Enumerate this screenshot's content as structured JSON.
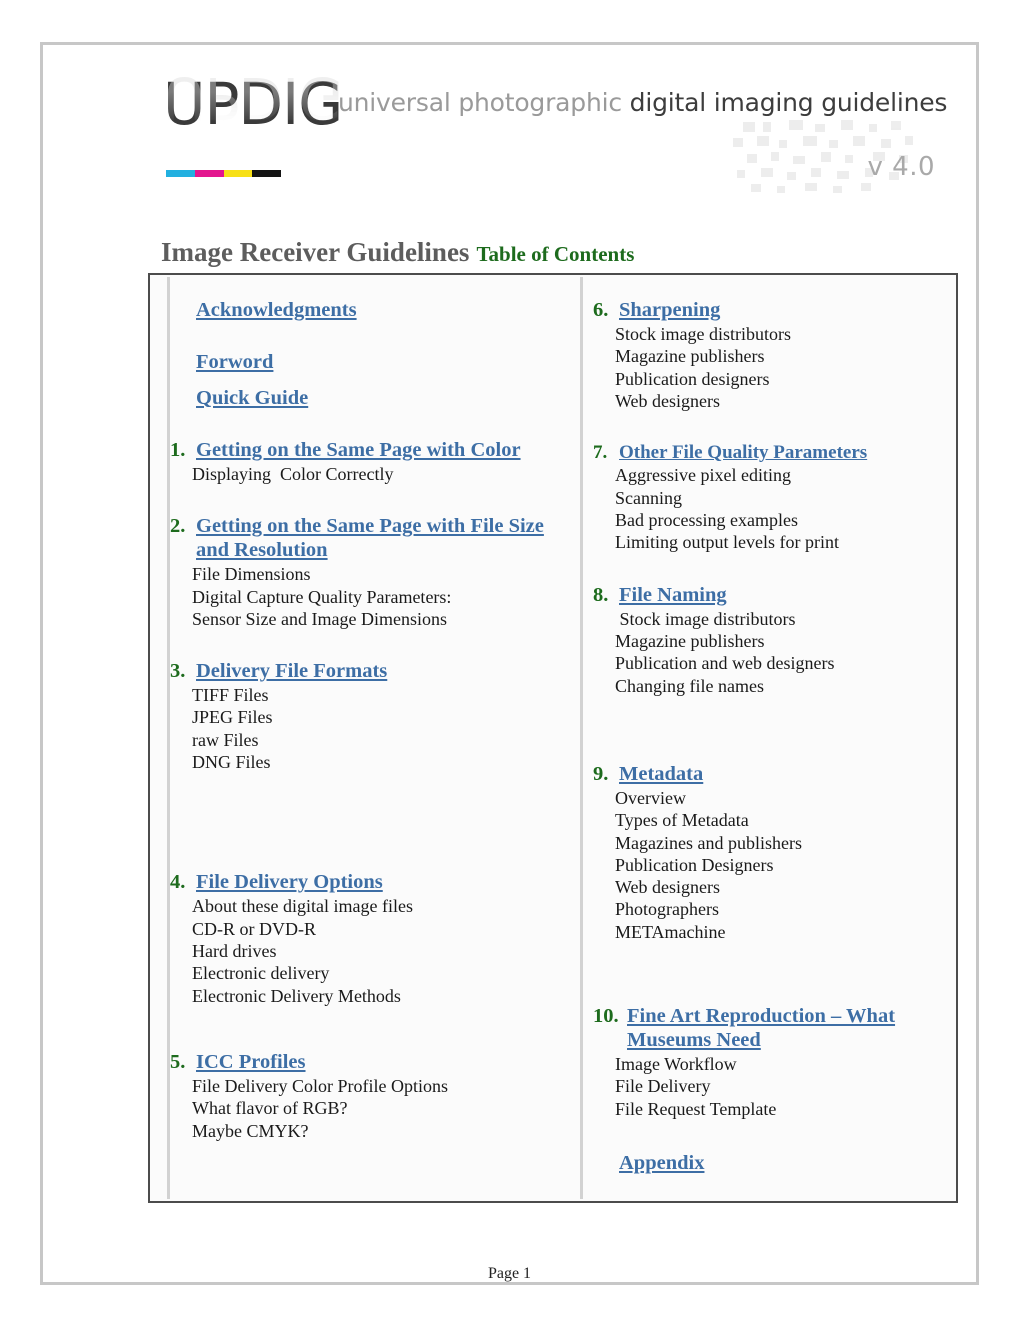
{
  "logo": {
    "wordmark": "UPDIG",
    "tagline_light": "universal photographic ",
    "tagline_bold": "digital imaging guidelines",
    "version": "v 4.0",
    "cmyk_colors": [
      "#22b0e0",
      "#e3168f",
      "#f7e017",
      "#141414"
    ]
  },
  "title": {
    "main": "Image Receiver Guidelines",
    "sub": "Table of Contents",
    "main_color": "#5d5d5d",
    "sub_color": "#1d6b1d"
  },
  "colors": {
    "link": "#3d6ea5",
    "number": "#1d6b1d",
    "body_text": "#1a1a1a",
    "table_border": "#4c4c4c",
    "cell_border": "#d2d2d2",
    "page_border": "#c7c7c7"
  },
  "toc": {
    "left_column": [
      {
        "number": "",
        "label": "Acknowledgments",
        "is_link": true,
        "sub_items": [],
        "gap_after": 28
      },
      {
        "number": "",
        "label": "Forword",
        "is_link": true,
        "sub_items": [],
        "gap_after": 12
      },
      {
        "number": "",
        "label": "Quick Guide",
        "is_link": true,
        "sub_items": [],
        "gap_after": 28
      },
      {
        "number": "1.",
        "label": "Getting on the Same Page with Color",
        "is_link": true,
        "sub_items": [
          "Displaying  Color Correctly"
        ],
        "gap_after": 30
      },
      {
        "number": "2.",
        "label": "Getting on the Same Page with File Size and Resolution",
        "is_link": true,
        "sub_items": [
          "File Dimensions",
          "Digital Capture Quality Parameters:",
          "Sensor Size and Image Dimensions"
        ],
        "gap_after": 30
      },
      {
        "number": "3.",
        "label": "Delivery File Formats",
        "is_link": true,
        "sub_items": [
          "TIFF Files",
          "JPEG Files",
          "raw Files",
          "DNG Files"
        ],
        "gap_after": 98
      },
      {
        "number": "4.",
        "label": "File Delivery Options",
        "is_link": true,
        "sub_items": [
          "About these digital image files",
          "CD-R or DVD-R",
          "Hard drives",
          "Electronic delivery",
          "Electronic Delivery Methods"
        ],
        "gap_after": 44
      },
      {
        "number": "5.",
        "label": "ICC Profiles",
        "is_link": true,
        "sub_items": [
          "File Delivery Color Profile Options",
          "What flavor of RGB?",
          "Maybe CMYK?"
        ],
        "gap_after": 0
      }
    ],
    "right_column": [
      {
        "number": "6.",
        "label": "Sharpening",
        "is_link": true,
        "sub_items": [
          "Stock image distributors",
          "Magazine publishers",
          "Publication designers",
          "Web designers"
        ],
        "gap_after": 30
      },
      {
        "number": "7.",
        "label": "Other File Quality Parameters",
        "is_link": true,
        "small_head": true,
        "sub_items": [
          "Aggressive pixel editing",
          "Scanning",
          "Bad processing examples",
          "Limiting output levels for print"
        ],
        "gap_after": 30
      },
      {
        "number": "8.",
        "label": "File Naming",
        "is_link": true,
        "sub_items": [
          " Stock image distributors",
          "Magazine publishers",
          "Publication and web designers",
          "Changing file names"
        ],
        "gap_after": 66
      },
      {
        "number": "9.",
        "label": "Metadata",
        "is_link": true,
        "sub_items": [
          "Overview",
          "Types of Metadata",
          "Magazines and publishers",
          "Publication Designers",
          "Web designers",
          "Photographers",
          "METAmachine"
        ],
        "gap_after": 62
      },
      {
        "number": "10.",
        "label": "Fine Art Reproduction – What Museums Need",
        "is_link": true,
        "sub_items": [
          "Image Workflow",
          "File Delivery",
          "File Request Template"
        ],
        "gap_after": 32
      },
      {
        "number": "",
        "label": "Appendix",
        "is_link": true,
        "sub_items": [],
        "gap_after": 0
      }
    ]
  },
  "footer": {
    "page_label": "Page 1"
  }
}
